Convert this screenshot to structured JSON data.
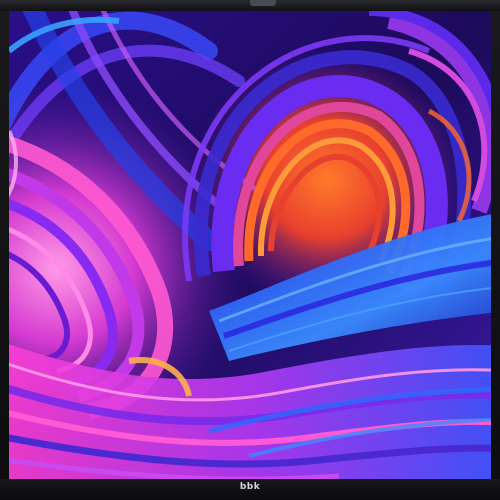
{
  "device": {
    "brand_label": "bbk",
    "frame_color": "#111114"
  },
  "wallpaper": {
    "description_colors": [
      "#1b0a5c",
      "#3a22c9",
      "#7b2ff0",
      "#e43fd6",
      "#ff6a2a",
      "#2f7bff"
    ]
  }
}
